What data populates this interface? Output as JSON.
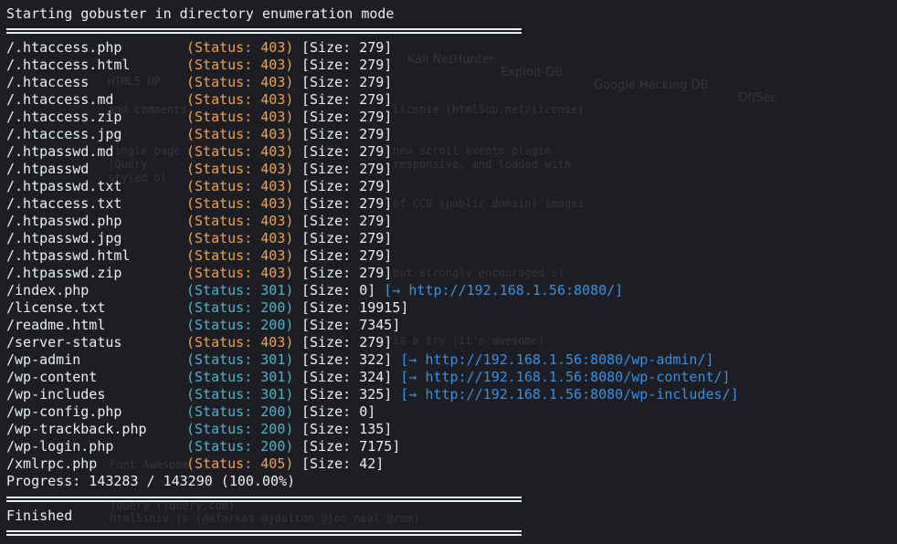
{
  "header": "Starting gobuster in directory enumeration mode",
  "results": [
    {
      "path": "/.htaccess.php",
      "status": "(Status: 403)",
      "code": "403",
      "size": "[Size: 279]",
      "redirect": ""
    },
    {
      "path": "/.htaccess.html",
      "status": "(Status: 403)",
      "code": "403",
      "size": "[Size: 279]",
      "redirect": ""
    },
    {
      "path": "/.htaccess",
      "status": "(Status: 403)",
      "code": "403",
      "size": "[Size: 279]",
      "redirect": ""
    },
    {
      "path": "/.htaccess.md",
      "status": "(Status: 403)",
      "code": "403",
      "size": "[Size: 279]",
      "redirect": ""
    },
    {
      "path": "/.htaccess.zip",
      "status": "(Status: 403)",
      "code": "403",
      "size": "[Size: 279]",
      "redirect": ""
    },
    {
      "path": "/.htaccess.jpg",
      "status": "(Status: 403)",
      "code": "403",
      "size": "[Size: 279]",
      "redirect": ""
    },
    {
      "path": "/.htpasswd.md",
      "status": "(Status: 403)",
      "code": "403",
      "size": "[Size: 279]",
      "redirect": ""
    },
    {
      "path": "/.htpasswd",
      "status": "(Status: 403)",
      "code": "403",
      "size": "[Size: 279]",
      "redirect": ""
    },
    {
      "path": "/.htpasswd.txt",
      "status": "(Status: 403)",
      "code": "403",
      "size": "[Size: 279]",
      "redirect": ""
    },
    {
      "path": "/.htaccess.txt",
      "status": "(Status: 403)",
      "code": "403",
      "size": "[Size: 279]",
      "redirect": ""
    },
    {
      "path": "/.htpasswd.php",
      "status": "(Status: 403)",
      "code": "403",
      "size": "[Size: 279]",
      "redirect": ""
    },
    {
      "path": "/.htpasswd.jpg",
      "status": "(Status: 403)",
      "code": "403",
      "size": "[Size: 279]",
      "redirect": ""
    },
    {
      "path": "/.htpasswd.html",
      "status": "(Status: 403)",
      "code": "403",
      "size": "[Size: 279]",
      "redirect": ""
    },
    {
      "path": "/.htpasswd.zip",
      "status": "(Status: 403)",
      "code": "403",
      "size": "[Size: 279]",
      "redirect": ""
    },
    {
      "path": "/index.php",
      "status": "(Status: 301)",
      "code": "301",
      "size": "[Size: 0]",
      "redirect": "[→ http://192.168.1.56:8080/]"
    },
    {
      "path": "/license.txt",
      "status": "(Status: 200)",
      "code": "200",
      "size": "[Size: 19915]",
      "redirect": ""
    },
    {
      "path": "/readme.html",
      "status": "(Status: 200)",
      "code": "200",
      "size": "[Size: 7345]",
      "redirect": ""
    },
    {
      "path": "/server-status",
      "status": "(Status: 403)",
      "code": "403",
      "size": "[Size: 279]",
      "redirect": ""
    },
    {
      "path": "/wp-admin",
      "status": "(Status: 301)",
      "code": "301",
      "size": "[Size: 322]",
      "redirect": "[→ http://192.168.1.56:8080/wp-admin/]"
    },
    {
      "path": "/wp-content",
      "status": "(Status: 301)",
      "code": "301",
      "size": "[Size: 324]",
      "redirect": "[→ http://192.168.1.56:8080/wp-content/]"
    },
    {
      "path": "/wp-includes",
      "status": "(Status: 301)",
      "code": "301",
      "size": "[Size: 325]",
      "redirect": "[→ http://192.168.1.56:8080/wp-includes/]"
    },
    {
      "path": "/wp-config.php",
      "status": "(Status: 200)",
      "code": "200",
      "size": "[Size: 0]",
      "redirect": ""
    },
    {
      "path": "/wp-trackback.php",
      "status": "(Status: 200)",
      "code": "200",
      "size": "[Size: 135]",
      "redirect": ""
    },
    {
      "path": "/wp-login.php",
      "status": "(Status: 200)",
      "code": "200",
      "size": "[Size: 7175]",
      "redirect": ""
    },
    {
      "path": "/xmlrpc.php",
      "status": "(Status: 405)",
      "code": "405",
      "size": "[Size: 42]",
      "redirect": ""
    }
  ],
  "progress": "Progress: 143283 / 143290 (100.00%)",
  "finished": "Finished",
  "ghost": {
    "bookmarks": [
      "Kali NetHunter",
      "Exploit-DB",
      "Google Hacking DB",
      "OffSec"
    ],
    "lines": [
      "HTML5 UP",
      "and comments",
      "license (html5up.net/license)",
      "single page",
      "new scroll events plugin",
      "jQuery",
      "responsive, and loaded with",
      "styled ol",
      "of CC0 (public domain) images",
      "but strongly encouraged :)",
      "is a try (it's awesome)",
      "Font Awesome",
      "jQuery (jquery.com)",
      "html5shiv.js (@afarkas @jdalton @jon_neal @rem)"
    ]
  }
}
